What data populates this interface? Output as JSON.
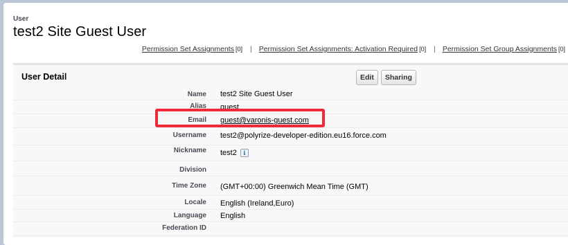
{
  "header": {
    "breadcrumb": "User",
    "title": "test2 Site Guest User"
  },
  "related_links": [
    {
      "label": "Permission Set Assignments",
      "count": "[0]"
    },
    {
      "label": "Permission Set Assignments: Activation Required",
      "count": "[0]"
    },
    {
      "label": "Permission Set Group Assignments",
      "count": "[0]"
    }
  ],
  "separator": "|",
  "detail": {
    "section_title": "User Detail",
    "edit_label": "Edit",
    "sharing_label": "Sharing",
    "fields": [
      {
        "label": "Name",
        "value": "test2 Site Guest User"
      },
      {
        "label": "Alias",
        "value": "guest"
      },
      {
        "label": "Email",
        "value": "guest@varonis-guest.com"
      },
      {
        "label": "Username",
        "value": "test2@polyrize-developer-edition.eu16.force.com"
      },
      {
        "label": "Nickname",
        "value": "test2"
      },
      {
        "label": "Division",
        "value": ""
      },
      {
        "label": "Time Zone",
        "value": "(GMT+00:00) Greenwich Mean Time (GMT)"
      },
      {
        "label": "Locale",
        "value": "English (Ireland,Euro)"
      },
      {
        "label": "Language",
        "value": "English"
      },
      {
        "label": "Federation ID",
        "value": ""
      }
    ],
    "nickname_info_icon": "info-icon",
    "highlight_color": "#ef2b3a"
  }
}
